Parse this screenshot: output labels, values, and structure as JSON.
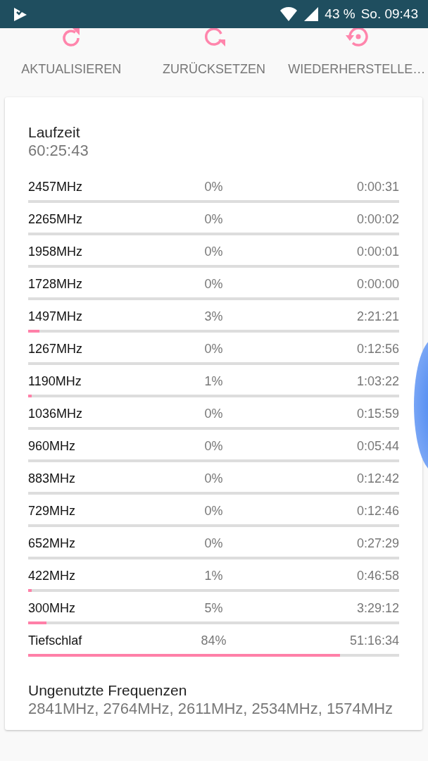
{
  "status_bar": {
    "battery": "43 %",
    "time": "So. 09:43"
  },
  "actions": [
    {
      "label": "AKTUALISIEREN",
      "kind": "refresh"
    },
    {
      "label": "ZURÜCKSETZEN",
      "kind": "reset"
    },
    {
      "label": "WIEDERHERSTELLE…",
      "kind": "restore"
    }
  ],
  "card": {
    "uptime_label": "Laufzeit",
    "uptime": "60:25:43",
    "rows": [
      {
        "freq": "2457MHz",
        "percent": "0%",
        "time": "0:00:31"
      },
      {
        "freq": "2265MHz",
        "percent": "0%",
        "time": "0:00:02"
      },
      {
        "freq": "1958MHz",
        "percent": "0%",
        "time": "0:00:01"
      },
      {
        "freq": "1728MHz",
        "percent": "0%",
        "time": "0:00:00"
      },
      {
        "freq": "1497MHz",
        "percent": "3%",
        "time": "2:21:21",
        "level": 0.03
      },
      {
        "freq": "1267MHz",
        "percent": "0%",
        "time": "0:12:56"
      },
      {
        "freq": "1190MHz",
        "percent": "1%",
        "time": "1:03:22",
        "level": 0.01
      },
      {
        "freq": "1036MHz",
        "percent": "0%",
        "time": "0:15:59"
      },
      {
        "freq": "960MHz",
        "percent": "0%",
        "time": "0:05:44"
      },
      {
        "freq": "883MHz",
        "percent": "0%",
        "time": "0:12:42"
      },
      {
        "freq": "729MHz",
        "percent": "0%",
        "time": "0:12:46"
      },
      {
        "freq": "652MHz",
        "percent": "0%",
        "time": "0:27:29"
      },
      {
        "freq": "422MHz",
        "percent": "1%",
        "time": "0:46:58",
        "level": 0.01
      },
      {
        "freq": "300MHz",
        "percent": "5%",
        "time": "3:29:12",
        "level": 0.05
      },
      {
        "freq": "Tiefschlaf",
        "percent": "84%",
        "time": "51:16:34",
        "level": 0.84
      }
    ],
    "unused_label": "Ungenutzte Frequenzen",
    "unused": "2841MHz, 2764MHz, 2611MHz, 2534MHz, 1574MHz"
  }
}
